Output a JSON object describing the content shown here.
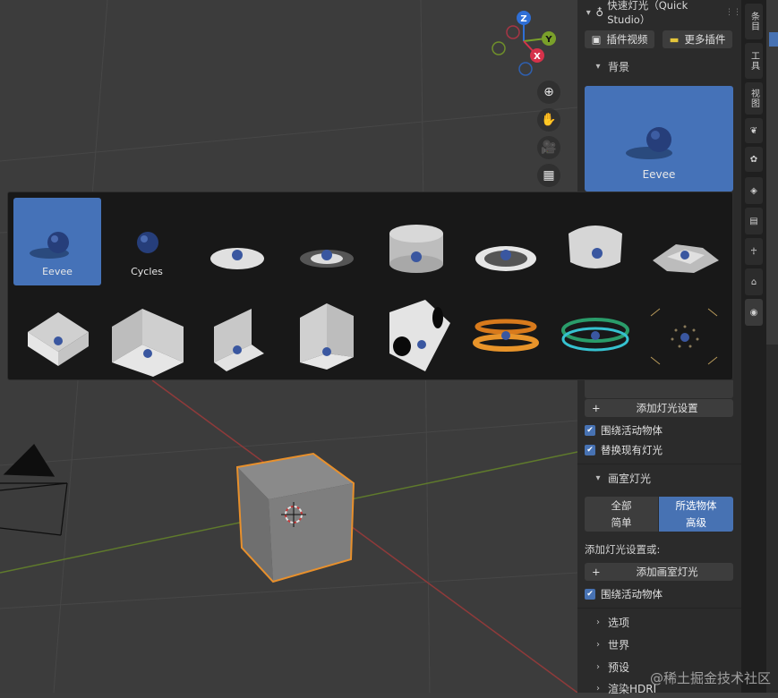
{
  "panel": {
    "title": "快速灯光（Quick Studio）",
    "plugin_video_label": "插件视频",
    "more_plugins_label": "更多插件",
    "background_section": "背景",
    "bg_preview_label": "Eevee",
    "add_light_setup_label": "添加灯光设置",
    "around_active_label": "围绕活动物体",
    "replace_lights_label": "替换现有灯光",
    "studio_light_section": "画室灯光",
    "mode_all": "全部",
    "mode_selected": "所选物体",
    "mode_simple": "简单",
    "mode_advanced": "高级",
    "add_setup_or_label": "添加灯光设置或:",
    "add_studio_light_label": "添加画室灯光",
    "around_active_label2": "围绕活动物体",
    "options_section": "选项",
    "world_section": "世界",
    "preset_section": "预设",
    "render_hdri_section": "渲染HDRI"
  },
  "sidetabs": {
    "item": "条目",
    "tool": "工具",
    "view": "视图"
  },
  "popup": {
    "thumbs_row1": [
      "Eevee",
      "Cycles",
      "",
      "",
      "",
      "",
      "",
      ""
    ],
    "selected_index": 0
  },
  "watermark": "@稀土掘金技术社区",
  "colors": {
    "accent": "#4772b3",
    "panel_bg": "#2b2b2b",
    "viewport_bg": "#3c3c3c",
    "selection_outline": "#e8902c"
  }
}
